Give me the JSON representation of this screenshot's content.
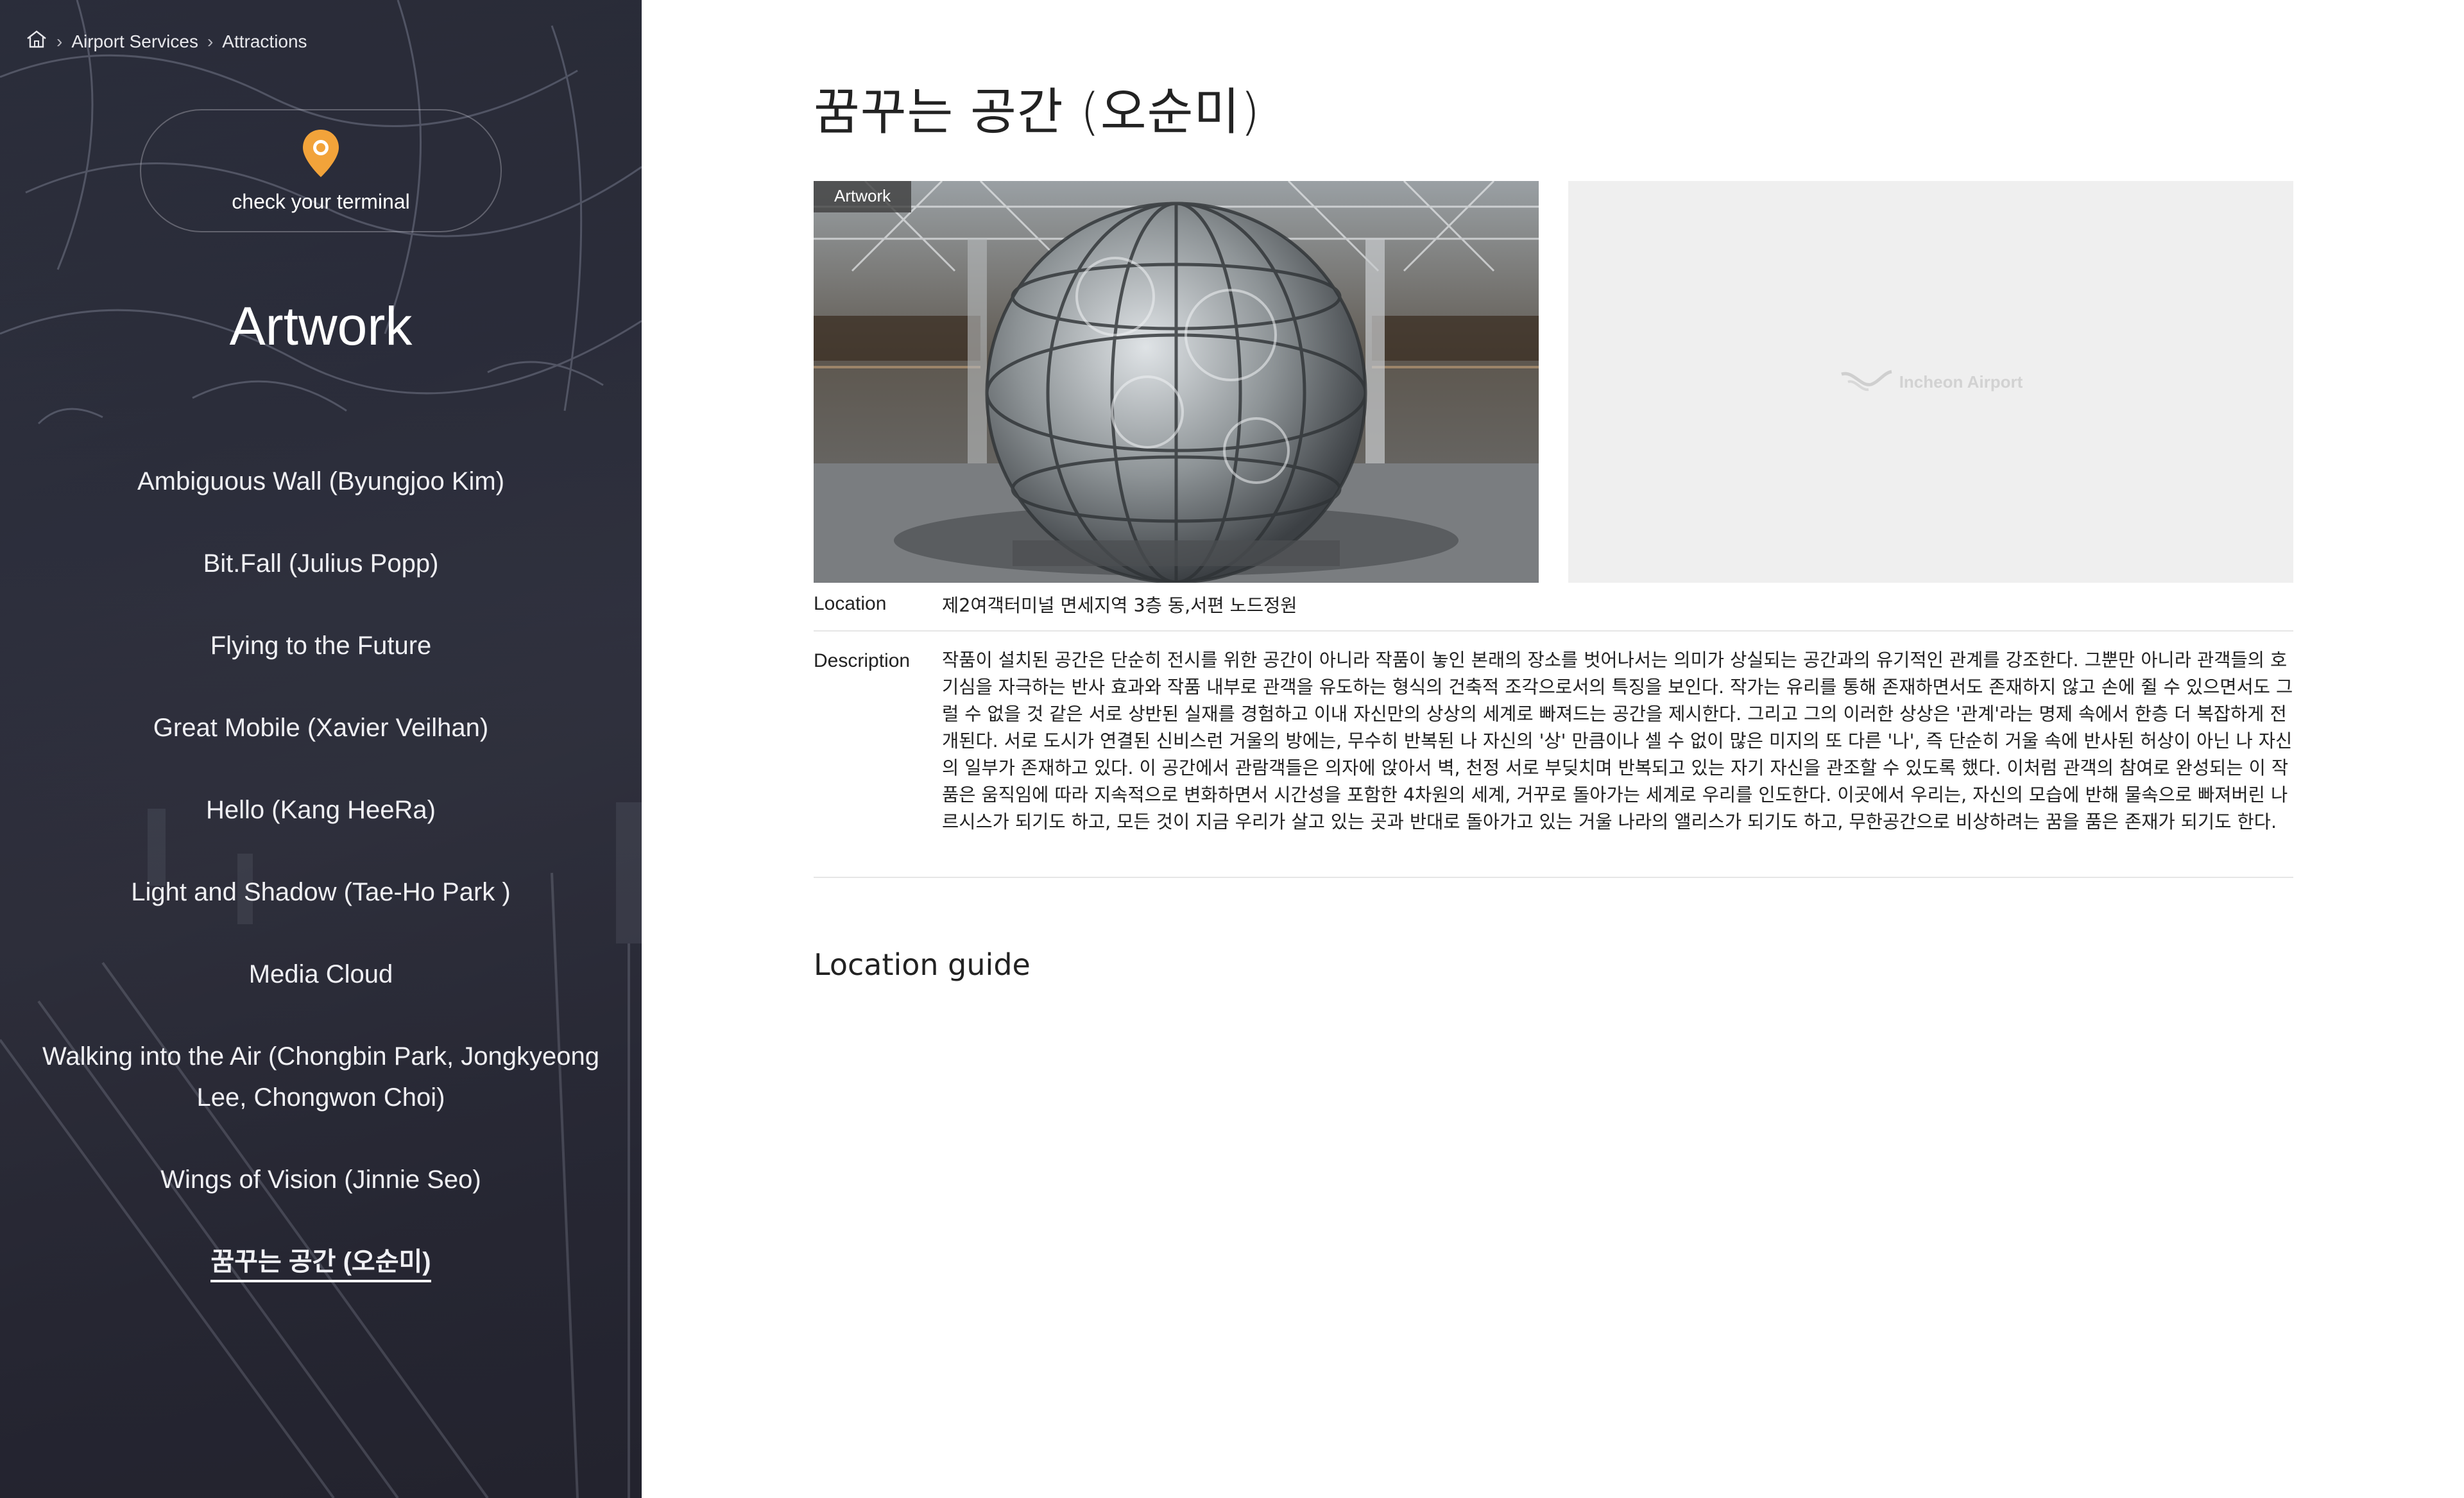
{
  "breadcrumb": {
    "home_icon": "home-icon",
    "items": [
      "Airport Services",
      "Attractions"
    ]
  },
  "terminal": {
    "label": "check your terminal",
    "icon": "location-pin-icon",
    "icon_color": "#f2a33a"
  },
  "sidebar": {
    "title": "Artwork",
    "items": [
      "Ambiguous Wall (Byungjoo Kim)",
      "Bit.Fall (Julius Popp)",
      "Flying to the Future",
      "Great Mobile (Xavier Veilhan)",
      "Hello (Kang HeeRa)",
      "Light and Shadow (Tae-Ho Park )",
      "Media Cloud",
      "Walking into the Air (Chongbin Park, Jongkyeong Lee, Chongwon Choi)",
      "Wings of Vision (Jinnie Seo)",
      "꿈꾸는 공간 (오순미)"
    ],
    "active_index": 9
  },
  "main": {
    "title": "꿈꾸는 공간 (오순미)",
    "photo_tag": "Artwork",
    "placeholder_logo": "Incheon Airport",
    "location_label": "Location",
    "location_value": "제2여객터미널 면세지역 3층 동,서편 노드정원",
    "description_label": "Description",
    "description_value": "작품이 설치된 공간은 단순히 전시를 위한 공간이 아니라 작품이 놓인 본래의 장소를 벗어나서는 의미가 상실되는 공간과의 유기적인 관계를 강조한다. 그뿐만 아니라 관객들의 호기심을 자극하는 반사 효과와 작품 내부로 관객을 유도하는 형식의 건축적 조각으로서의 특징을 보인다. 작가는 유리를 통해 존재하면서도 존재하지 않고 손에 쥘 수 있으면서도 그럴 수 없을 것 같은 서로 상반된 실재를 경험하고 이내 자신만의 상상의 세계로 빠져드는 공간을 제시한다. 그리고 그의 이러한 상상은 '관계'라는 명제 속에서 한층 더 복잡하게 전개된다. 서로 도시가 연결된 신비스런 거울의 방에는, 무수히 반복된 나 자신의 '상' 만큼이나 셀 수 없이 많은 미지의 또 다른 '나', 즉 단순히 거울 속에 반사된 허상이 아닌 나 자신의 일부가 존재하고 있다. 이 공간에서 관람객들은 의자에 앉아서 벽, 천정 서로 부딪치며 반복되고 있는 자기 자신을 관조할 수 있도록 했다. 이처럼 관객의 참여로 완성되는 이 작품은 움직임에 따라 지속적으로 변화하면서 시간성을 포함한 4차원의 세계, 거꾸로 돌아가는 세계로 우리를 인도한다. 이곳에서 우리는, 자신의 모습에 반해 물속으로 빠져버린 나르시스가 되기도 하고, 모든 것이 지금 우리가 살고 있는 곳과 반대로 돌아가고 있는 거울 나라의 앨리스가 되기도 하고, 무한공간으로 비상하려는 꿈을 품은 존재가 되기도 한다.",
    "location_guide_title": "Location guide"
  }
}
